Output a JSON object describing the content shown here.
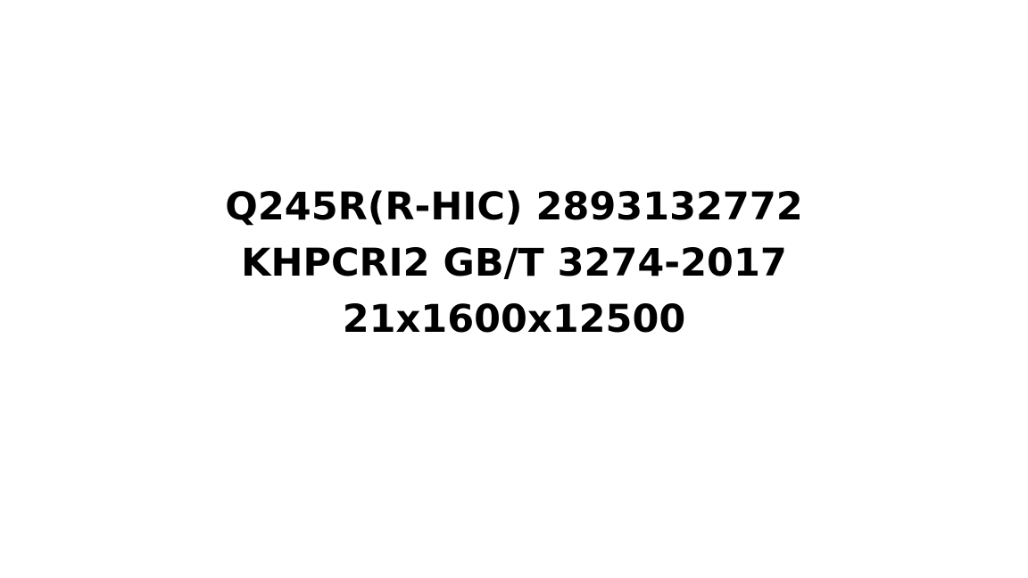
{
  "lines": [
    "Q245R(R-HIC) 2893132772",
    "KHPCRI2 GB/T 3274-2017",
    "21x1600x12500"
  ],
  "colors": {
    "background": "#ffffff",
    "text": "#000000"
  }
}
